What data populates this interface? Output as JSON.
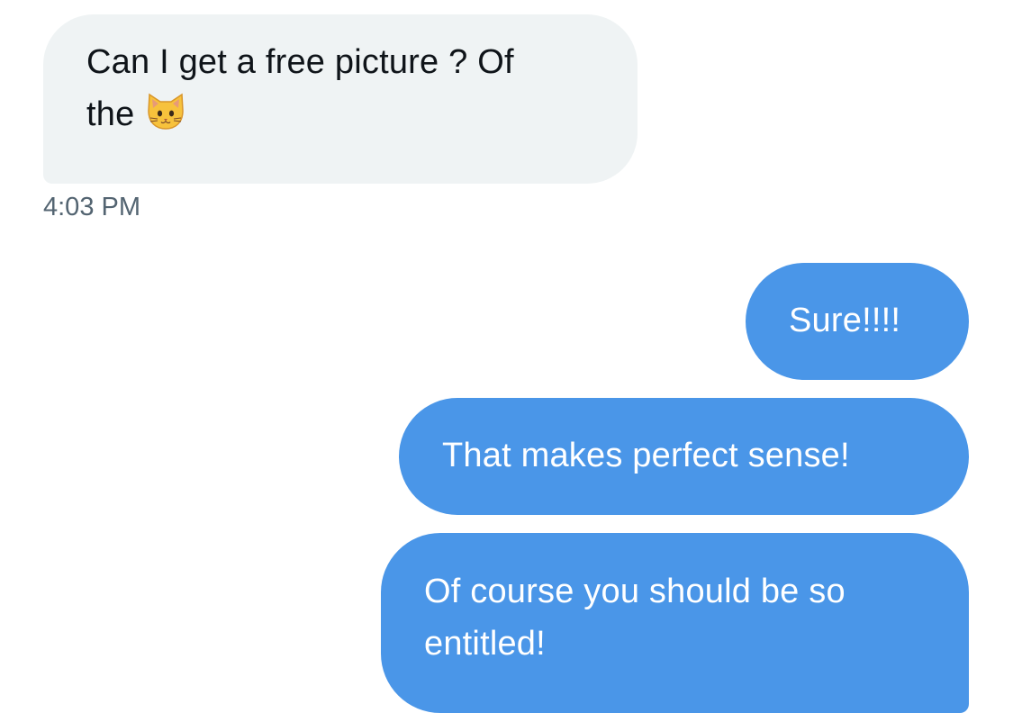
{
  "conversation": {
    "incoming_message": {
      "line1": "Can I get a free picture ? Of",
      "line2": "the",
      "emoji": "cat-face",
      "timestamp": "4:03 PM"
    },
    "outgoing_messages": [
      {
        "text": "Sure!!!!"
      },
      {
        "text": "That makes perfect sense!"
      },
      {
        "line1": "Of course you should be so",
        "line2": "entitled!"
      }
    ]
  },
  "colors": {
    "incoming_bubble": "#eff3f4",
    "incoming_text": "#0f1419",
    "outgoing_bubble": "#4a96e8",
    "outgoing_text": "#ffffff",
    "timestamp_text": "#536471"
  }
}
